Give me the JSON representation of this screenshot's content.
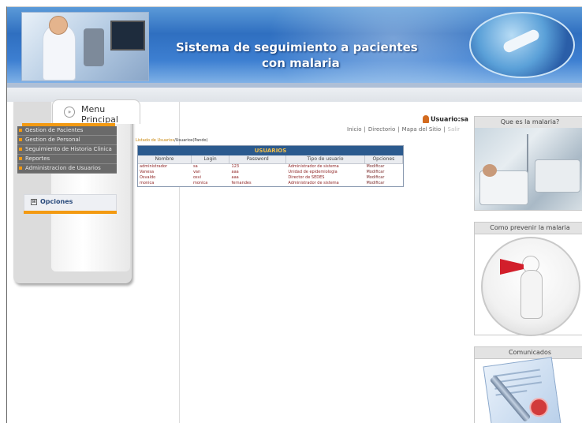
{
  "header": {
    "title_line1": "Sistema de seguimiento a pacientes",
    "title_line2": "con malaria"
  },
  "sidebar": {
    "title": "Menu Principal",
    "chevron": "»",
    "items": [
      {
        "label": "Gestion de Pacientes"
      },
      {
        "label": "Gestion de Personal"
      },
      {
        "label": "Seguimiento de Historia Clinica"
      },
      {
        "label": "Reportes"
      },
      {
        "label": "Administracion de Usuarios"
      }
    ],
    "options_label": "Opciones",
    "options_icon": "⊞"
  },
  "topbar": {
    "user_label": "Usuario:sa",
    "links": [
      "Inicio",
      "Directorio",
      "Mapa del Sitio",
      "Salir"
    ],
    "separator": "|"
  },
  "breadcrumb": {
    "link": "Listado de Usuarios",
    "current": "/Usuarios(Pando)"
  },
  "users_table": {
    "title": "USUARIOS",
    "columns": [
      "Nombre",
      "Login",
      "Password",
      "Tipo de usuario",
      "Opciones"
    ],
    "rows": [
      [
        "administrador",
        "sa",
        "123",
        "Administrador de sistema",
        "Modificar"
      ],
      [
        "Vanesa",
        "van",
        "aaa",
        "Unidad de epidemiologia",
        "Modificar"
      ],
      [
        "Osvaldo",
        "osvi",
        "aaa",
        "Director de SEDES",
        "Modificar"
      ],
      [
        "monica",
        "monica",
        "fernandes",
        "Administrador de sistema",
        "Modificar"
      ]
    ]
  },
  "right_panels": [
    {
      "title": "Que es la malaria?"
    },
    {
      "title": "Como prevenir la malaria"
    },
    {
      "title": "Comunicados"
    }
  ],
  "colors": {
    "header_blue": "#2f6fc0",
    "accent_orange": "#f39a12",
    "table_header": "#2b5a8e",
    "table_title_text": "#f3c04a",
    "row_text": "#8b1d1d"
  }
}
